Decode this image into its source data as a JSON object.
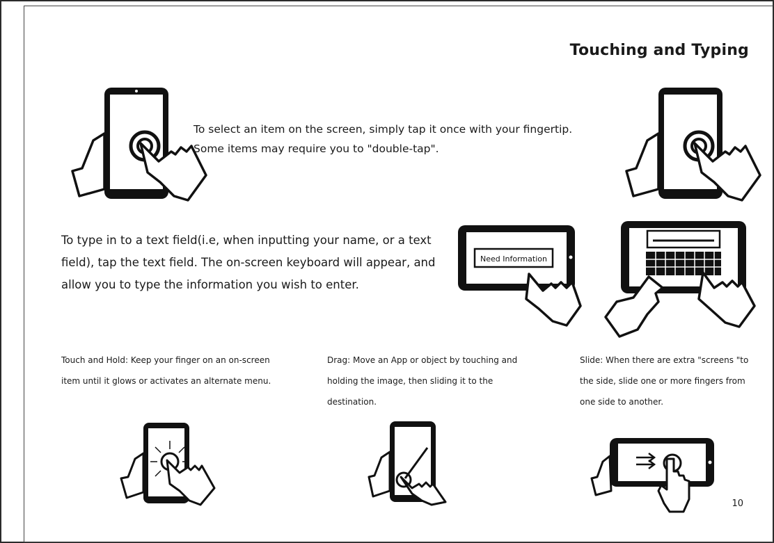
{
  "page": {
    "title": "Touching and Typing",
    "page_number": "10"
  },
  "tap": {
    "line1": "To select an item on the screen, simply tap it once with your fingertip.",
    "line2": "Some items may require you to \"double-tap\"."
  },
  "typing": {
    "text": "To type in to a text field(i.e, when inputting your name, or a text field), tap the text field. The on-screen keyboard will appear, and allow you to type the information you wish to enter.",
    "field_label": "Need Information"
  },
  "gestures": [
    {
      "text": "Touch and Hold: Keep your finger on an on-screen item until it glows or activates an alternate menu.",
      "icon": "touch-hold-icon"
    },
    {
      "text": "Drag: Move an App or object by touching and holding the image, then sliding it to the destination.",
      "icon": "drag-icon"
    },
    {
      "text": "Slide: When there are extra \"screens \"to the side, slide one or more fingers from one side to another.",
      "icon": "slide-icon"
    }
  ]
}
